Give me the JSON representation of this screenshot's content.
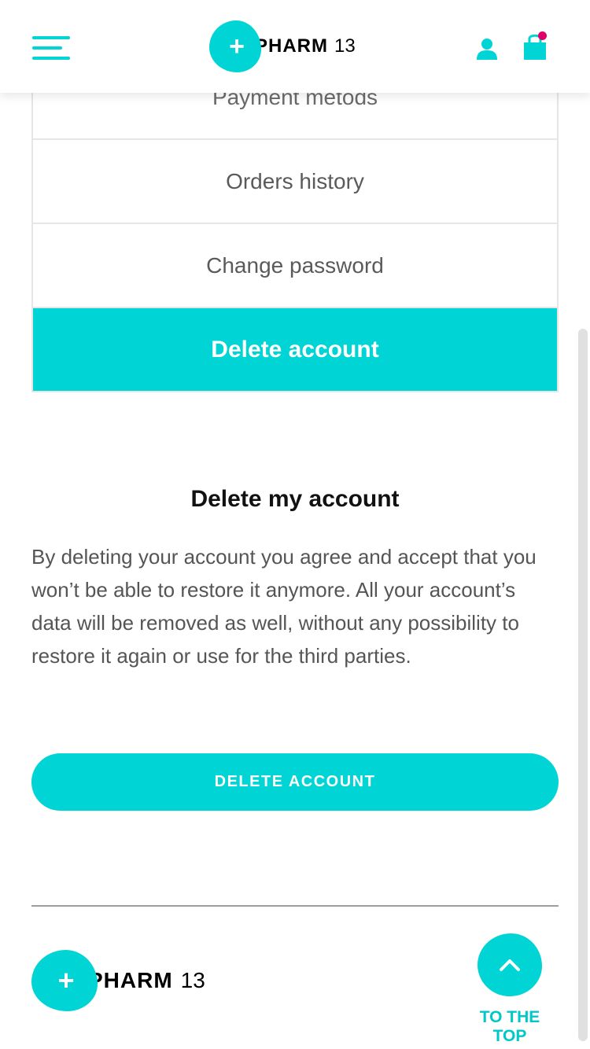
{
  "header": {
    "logo": {
      "plus": "+",
      "word": "PHARM",
      "number": "13"
    },
    "icons": {
      "menu": "hamburger-icon",
      "user": "user-icon",
      "cart": "cart-icon"
    }
  },
  "menu": {
    "items": [
      {
        "label": "Payment metods"
      },
      {
        "label": "Orders history"
      },
      {
        "label": "Change password"
      },
      {
        "label": "Delete account",
        "active": true
      }
    ]
  },
  "delete_section": {
    "title": "Delete my account",
    "body": "By deleting your account you agree and accept that you won’t be able to restore it anymore. All your account’s data will be removed as well, without any possibility to restore it again or use for the third parties.",
    "button_label": "DELETE ACCOUNT"
  },
  "footer": {
    "logo": {
      "plus": "+",
      "word": "PHARM",
      "number": "13"
    },
    "to_top_label": "TO THE TOP"
  },
  "colors": {
    "accent": "#00d4d4",
    "badge": "#e0006a"
  }
}
